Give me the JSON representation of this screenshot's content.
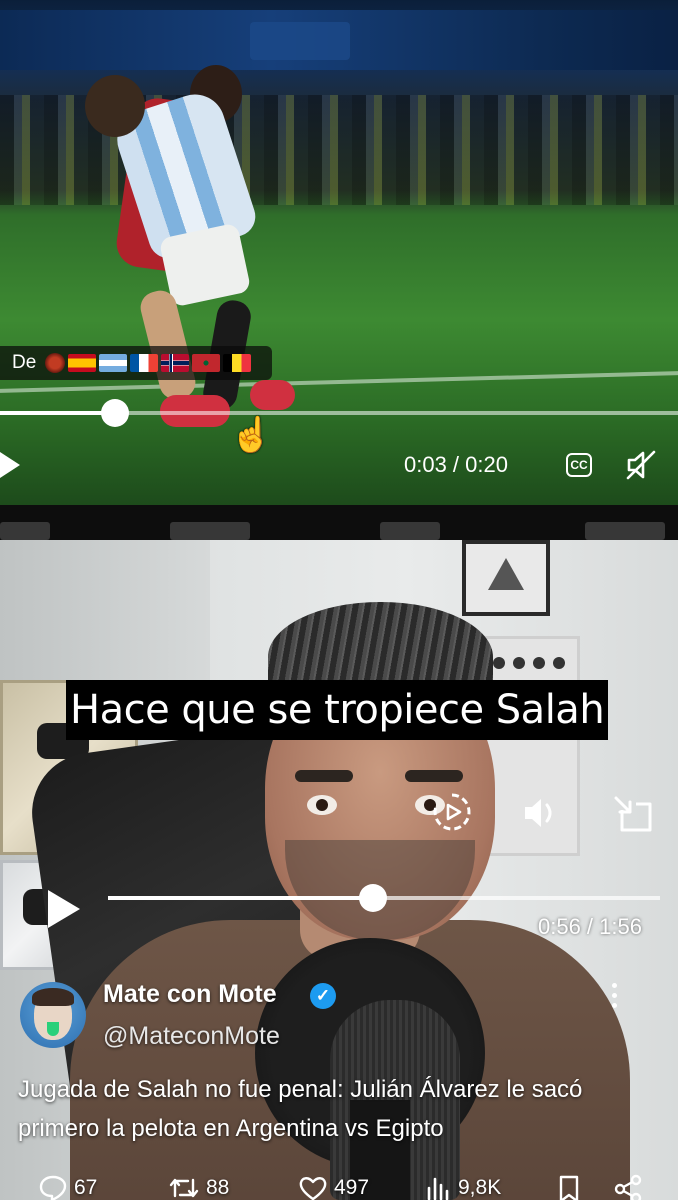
{
  "top_video": {
    "language_bar": {
      "label": "De",
      "flags": [
        "emblem",
        "spain",
        "argentina",
        "france",
        "norway",
        "morocco",
        "belgium"
      ]
    },
    "progress": 0.17,
    "time_display": "0:03 / 0:20",
    "cc_label": "CC",
    "icons": {
      "play": "play-icon",
      "captions": "cc-icon",
      "mute": "muted-speaker-icon",
      "cursor": "hand-pointer-icon"
    }
  },
  "bottom_video": {
    "subtitle": "Hace que se tropiece Salah",
    "progress": 0.48,
    "time_display": "0:56 / 1:56",
    "icons": {
      "replay": "replay-10-icon",
      "volume": "volume-icon",
      "pip": "picture-in-picture-icon",
      "play": "play-icon"
    }
  },
  "tweet": {
    "display_name": "Mate con Mote",
    "verified": true,
    "handle": "@MateconMote",
    "text": "Jugada de Salah no fue penal: Julián Álvarez le sacó primero la pelota en Argentina vs Egipto",
    "actions": {
      "replies": "67",
      "reposts": "88",
      "likes": "497",
      "views": "9,8K"
    }
  },
  "colors": {
    "verified_blue": "#1d9bf0",
    "overlay_text": "#ffffff",
    "background": "#000000"
  }
}
